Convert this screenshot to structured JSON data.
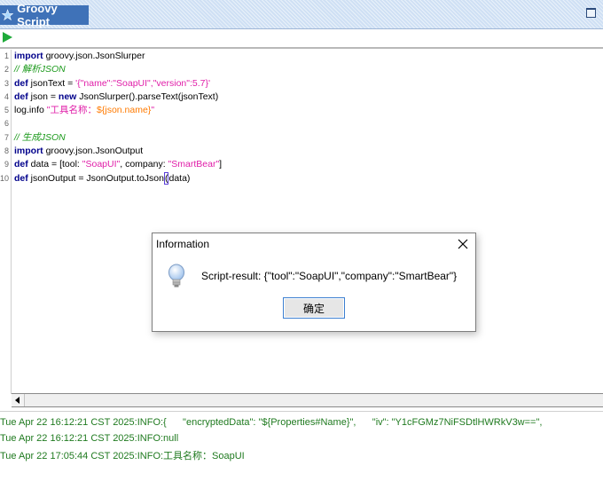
{
  "panel": {
    "title": "Groovy Script"
  },
  "editor": {
    "line_numbers": [
      "1",
      "2",
      "3",
      "4",
      "5",
      "6",
      "7",
      "8",
      "9",
      "10"
    ],
    "lines": [
      [
        {
          "t": "import",
          "c": "kw"
        },
        {
          "t": " groovy.json.JsonSlurper",
          "c": ""
        }
      ],
      [
        {
          "t": "// 解析JSON",
          "c": "cm"
        }
      ],
      [
        {
          "t": "def",
          "c": "kw"
        },
        {
          "t": " jsonText = ",
          "c": ""
        },
        {
          "t": "'{\"name\":\"SoapUI\",\"version\":5.7}'",
          "c": "st"
        }
      ],
      [
        {
          "t": "def",
          "c": "kw"
        },
        {
          "t": " json = ",
          "c": ""
        },
        {
          "t": "new",
          "c": "kw"
        },
        {
          "t": " JsonSlurper().parseText(jsonText)",
          "c": ""
        }
      ],
      [
        {
          "t": "log.info ",
          "c": ""
        },
        {
          "t": "\"工具名称：",
          "c": "st"
        },
        {
          "t": "${json.name}",
          "c": "iv"
        },
        {
          "t": "\"",
          "c": "st"
        }
      ],
      [],
      [
        {
          "t": "// 生成JSON",
          "c": "cm"
        }
      ],
      [
        {
          "t": "import",
          "c": "kw"
        },
        {
          "t": " groovy.json.JsonOutput",
          "c": ""
        }
      ],
      [
        {
          "t": "def",
          "c": "kw"
        },
        {
          "t": " data = [tool: ",
          "c": ""
        },
        {
          "t": "\"SoapUI\"",
          "c": "st"
        },
        {
          "t": ", company: ",
          "c": ""
        },
        {
          "t": "\"SmartBear\"",
          "c": "st"
        },
        {
          "t": "]",
          "c": ""
        }
      ],
      [
        {
          "t": "def",
          "c": "kw"
        },
        {
          "t": " jsonOutput = JsonOutput.toJson",
          "c": ""
        },
        {
          "t": "(",
          "c": "caret"
        },
        {
          "t": "data)",
          "c": ""
        }
      ]
    ]
  },
  "dialog": {
    "title": "Information",
    "message": "Script-result: {\"tool\":\"SoapUI\",\"company\":\"SmartBear\"}",
    "ok_label": "确定"
  },
  "log": {
    "lines": [
      "Tue Apr 22 16:12:21 CST 2025:INFO:{      \"encryptedData\": \"${Properties#Name}\",      \"iv\": \"Y1cFGMz7NiFSDtlHWRkV3w==\",",
      "Tue Apr 22 16:12:21 CST 2025:INFO:null",
      "Tue Apr 22 17:05:44 CST 2025:INFO:工具名称：SoapUI"
    ]
  },
  "colors": {
    "title_tab": "#3f72b8",
    "keyword": "#00008b",
    "comment": "#1c9a1c",
    "string": "#e01ea8",
    "interpolation": "#ff7a00",
    "log_text": "#1f7a1f"
  },
  "icons": [
    "star-icon",
    "run-icon",
    "close-icon",
    "lightbulb-icon",
    "arrow-left-icon",
    "maximize-icon"
  ]
}
